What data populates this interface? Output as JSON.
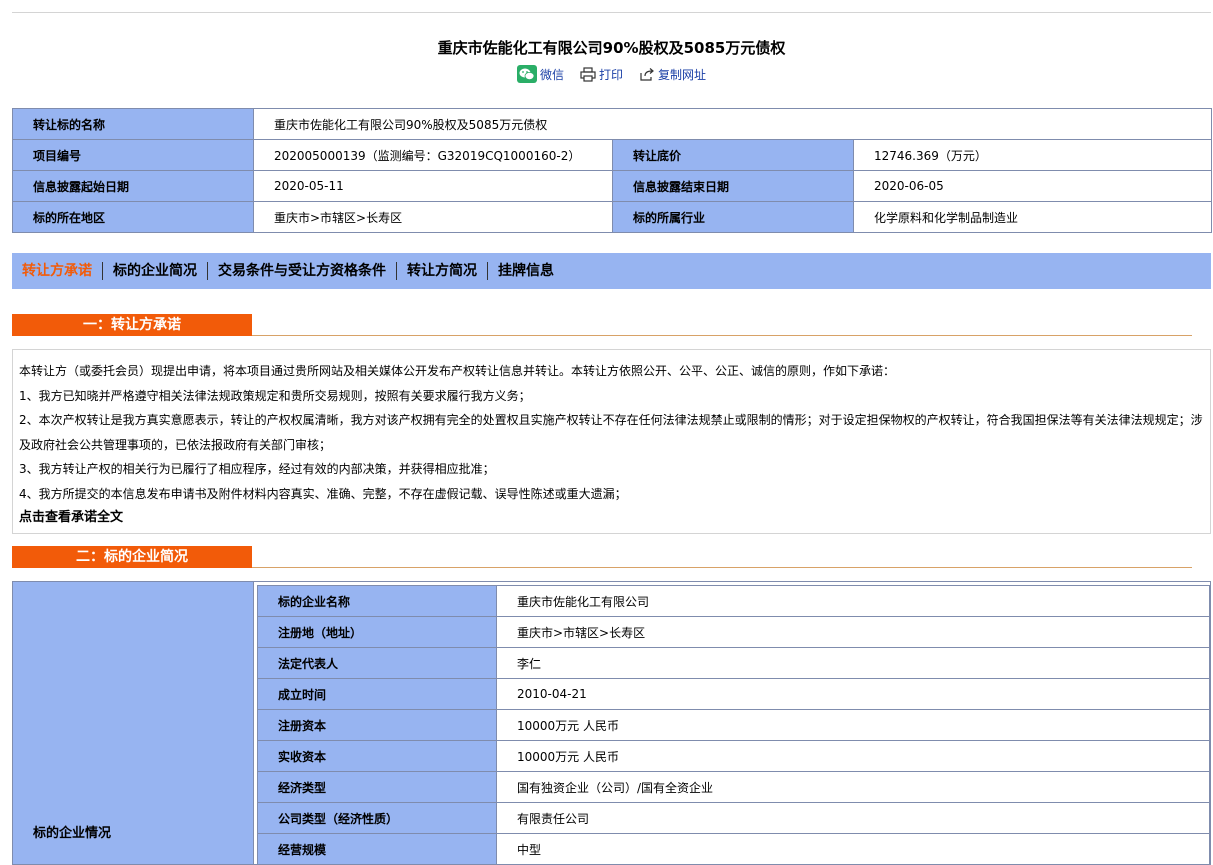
{
  "header": {
    "title": "重庆市佐能化工有限公司90%股权及5085万元债权",
    "share": {
      "wechat": "微信",
      "print": "打印",
      "copy_url": "复制网址"
    }
  },
  "info": {
    "subject_name_label": "转让标的名称",
    "subject_name": "重庆市佐能化工有限公司90%股权及5085万元债权",
    "project_no_label": "项目编号",
    "project_no": "202005000139（监测编号：G32019CQ1000160-2）",
    "base_price_label": "转让底价",
    "base_price": "12746.369（万元）",
    "start_date_label": "信息披露起始日期",
    "start_date": "2020-05-11",
    "end_date_label": "信息披露结束日期",
    "end_date": "2020-06-05",
    "region_label": "标的所在地区",
    "region": "重庆市>市辖区>长寿区",
    "industry_label": "标的所属行业",
    "industry": "化学原料和化学制品制造业"
  },
  "tabs": [
    "转让方承诺",
    "标的企业简况",
    "交易条件与受让方资格条件",
    "转让方简况",
    "挂牌信息"
  ],
  "section1": {
    "heading": "一：转让方承诺",
    "intro": "本转让方（或委托会员）现提出申请，将本项目通过贵所网站及相关媒体公开发布产权转让信息并转让。本转让方依照公开、公平、公正、诚信的原则，作如下承诺：",
    "item1": "1、我方已知晓并严格遵守相关法律法规政策规定和贵所交易规则，按照有关要求履行我方义务；",
    "item2": "2、本次产权转让是我方真实意愿表示，转让的产权权属清晰，我方对该产权拥有完全的处置权且实施产权转让不存在任何法律法规禁止或限制的情形；对于设定担保物权的产权转让，符合我国担保法等有关法律法规规定；涉及政府社会公共管理事项的，已依法报政府有关部门审核；",
    "item3": "3、我方转让产权的相关行为已履行了相应程序，经过有效的内部决策，并获得相应批准；",
    "item4": "4、我方所提交的本信息发布申请书及附件材料内容真实、准确、完整，不存在虚假记载、误导性陈述或重大遗漏；",
    "link": "点击查看承诺全文"
  },
  "section2": {
    "heading": "二：标的企业简况",
    "left_label": "标的企业情况",
    "rows": [
      {
        "label": "标的企业名称",
        "value": "重庆市佐能化工有限公司"
      },
      {
        "label": "注册地（地址）",
        "value": "重庆市>市辖区>长寿区"
      },
      {
        "label": "法定代表人",
        "value": "李仁"
      },
      {
        "label": "成立时间",
        "value": "2010-04-21"
      },
      {
        "label": "注册资本",
        "value": "10000万元 人民币"
      },
      {
        "label": "实收资本",
        "value": "10000万元 人民币"
      },
      {
        "label": "经济类型",
        "value": "国有独资企业（公司）/国有全资企业"
      },
      {
        "label": "公司类型（经济性质）",
        "value": "有限责任公司"
      },
      {
        "label": "经营规模",
        "value": "中型"
      }
    ]
  },
  "colors": {
    "label_bg": "#97b4f1",
    "accent": "#f25b09",
    "link": "#1a3fa6",
    "border": "#7f8cad"
  }
}
